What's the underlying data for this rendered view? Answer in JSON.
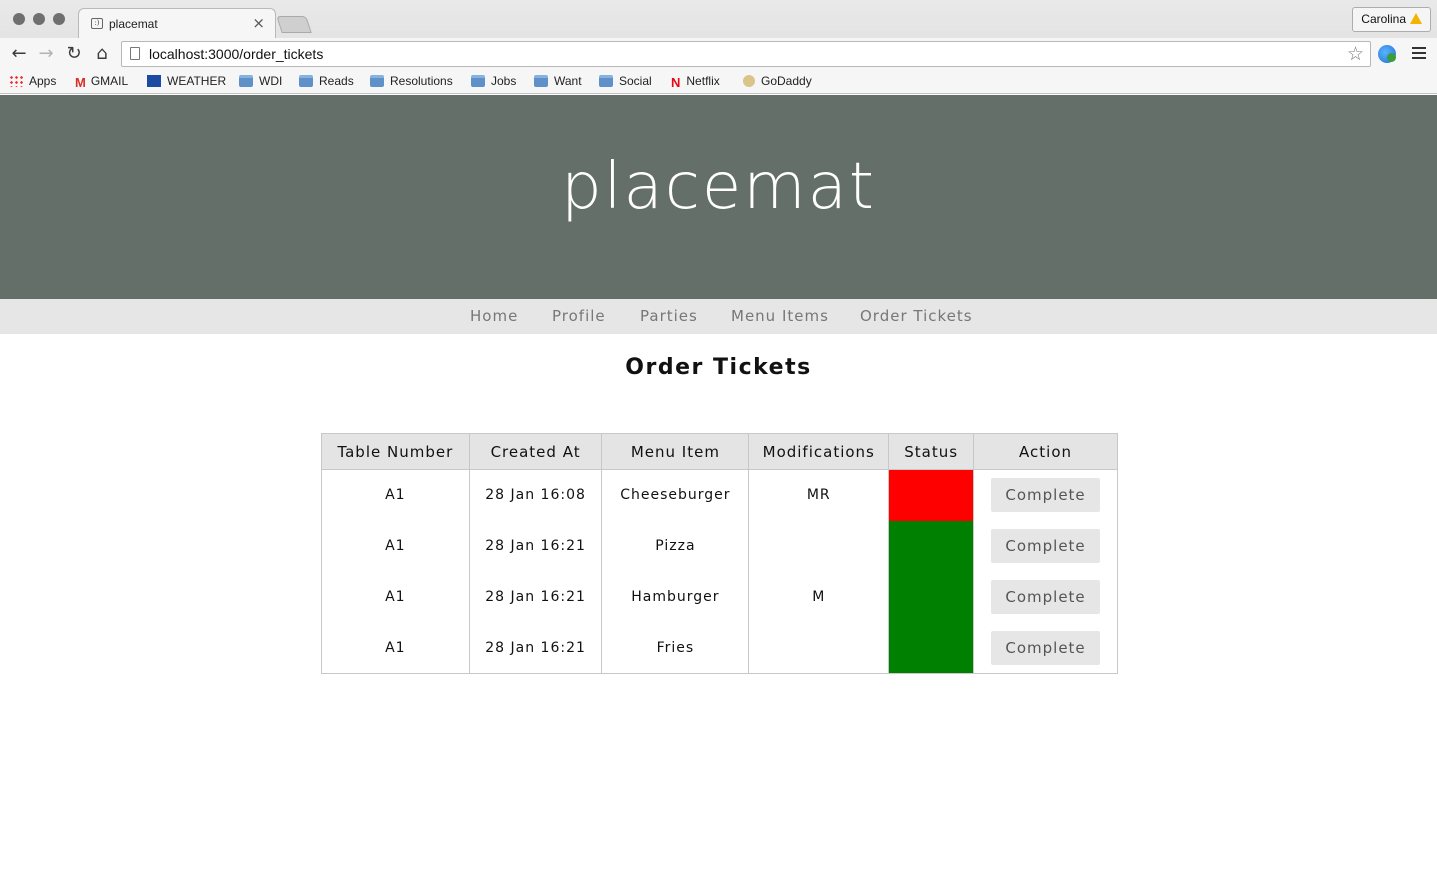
{
  "browser": {
    "tab_title": "placemat",
    "tab_close": "×",
    "profile_name": "Carolina",
    "url": "localhost:3000/order_tickets",
    "bookmarks": [
      {
        "label": "Apps",
        "icon": "apps-grid-icon"
      },
      {
        "label": "GMAIL",
        "icon": "gmail-icon"
      },
      {
        "label": "WEATHER",
        "icon": "weather-channel-icon"
      },
      {
        "label": "WDI",
        "icon": "folder-icon"
      },
      {
        "label": "Reads",
        "icon": "folder-icon"
      },
      {
        "label": "Resolutions",
        "icon": "folder-icon"
      },
      {
        "label": "Jobs",
        "icon": "folder-icon"
      },
      {
        "label": "Want",
        "icon": "folder-icon"
      },
      {
        "label": "Social",
        "icon": "folder-icon"
      },
      {
        "label": "Netflix",
        "icon": "netflix-icon"
      },
      {
        "label": "GoDaddy",
        "icon": "godaddy-icon"
      }
    ]
  },
  "site": {
    "title": "placemat",
    "nav": [
      "Home",
      "Profile",
      "Parties",
      "Menu Items",
      "Order Tickets"
    ],
    "header_bg": "#646f6a"
  },
  "page": {
    "heading": "Order Tickets",
    "columns": [
      "Table Number",
      "Created At",
      "Menu Item",
      "Modifications",
      "Status",
      "Action"
    ],
    "status_colors": {
      "pending": "#ff0000",
      "ready": "#008000"
    },
    "rows": [
      {
        "table": "A1",
        "created": "28 Jan 16:08",
        "item": "Cheeseburger",
        "mods": "MR",
        "status": "pending",
        "action": "Complete"
      },
      {
        "table": "A1",
        "created": "28 Jan 16:21",
        "item": "Pizza",
        "mods": "",
        "status": "ready",
        "action": "Complete"
      },
      {
        "table": "A1",
        "created": "28 Jan 16:21",
        "item": "Hamburger",
        "mods": "M",
        "status": "ready",
        "action": "Complete"
      },
      {
        "table": "A1",
        "created": "28 Jan 16:21",
        "item": "Fries",
        "mods": "",
        "status": "ready",
        "action": "Complete"
      }
    ]
  }
}
